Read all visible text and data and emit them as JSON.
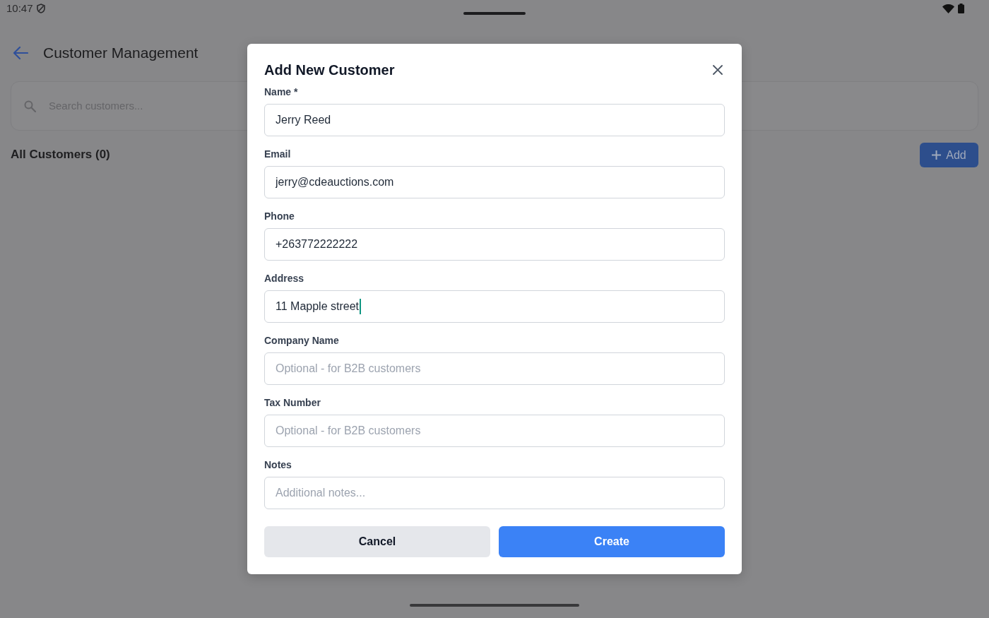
{
  "status_bar": {
    "time": "10:47"
  },
  "header": {
    "title": "Customer Management"
  },
  "search": {
    "placeholder": "Search customers..."
  },
  "list_heading": "All Customers (0)",
  "add_button": {
    "label": "Add"
  },
  "dialog": {
    "title": "Add New Customer",
    "fields": [
      {
        "label": "Name *",
        "value": "Jerry Reed",
        "focused": false
      },
      {
        "label": "Email",
        "value": "jerry@cdeauctions.com",
        "focused": false
      },
      {
        "label": "Phone",
        "value": "+263772222222",
        "focused": false
      },
      {
        "label": "Address",
        "value": "11 Mapple street",
        "focused": true
      },
      {
        "label": "Company Name",
        "placeholder": "Optional - for B2B customers",
        "focused": false
      },
      {
        "label": "Tax Number",
        "placeholder": "Optional - for B2B customers",
        "focused": false
      },
      {
        "label": "Notes",
        "placeholder": "Additional notes...",
        "focused": false
      }
    ],
    "buttons": [
      {
        "label": "Cancel",
        "kind": "secondary"
      },
      {
        "label": "Create",
        "kind": "primary"
      }
    ]
  }
}
